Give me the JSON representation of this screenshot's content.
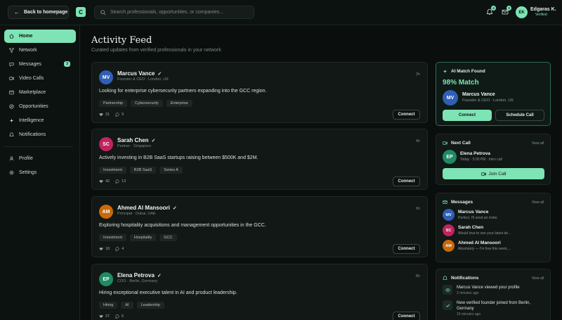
{
  "topbar": {
    "back_label": "Back to homepage",
    "logo_letter": "C",
    "search_placeholder": "Search professionals, opportunities, or companies...",
    "notifications_count": "4",
    "messages_count": "3",
    "user": {
      "initials": "EK",
      "name": "Edgaras K.",
      "status": "Verified"
    }
  },
  "sidebar": {
    "items": [
      {
        "label": "Home",
        "icon": "home-icon"
      },
      {
        "label": "Network",
        "icon": "network-icon"
      },
      {
        "label": "Messages",
        "icon": "chat-icon",
        "badge": "3"
      },
      {
        "label": "Video Calls",
        "icon": "video-icon"
      },
      {
        "label": "Marketplace",
        "icon": "store-icon"
      },
      {
        "label": "Opportunities",
        "icon": "compass-icon"
      },
      {
        "label": "Intelligence",
        "icon": "sparkle-icon"
      },
      {
        "label": "Notifications",
        "icon": "bell-icon"
      }
    ],
    "secondary": [
      {
        "label": "Profile",
        "icon": "user-icon"
      },
      {
        "label": "Settings",
        "icon": "gear-icon"
      }
    ]
  },
  "feed": {
    "title": "Activity Feed",
    "subtitle": "Curated updates from verified professionals in your network",
    "connect_label": "Connect",
    "posts": [
      {
        "initials": "MV",
        "color": "#2f5fb6",
        "name": "Marcus Vance",
        "role": "Founder & CEO · London, UK",
        "time": "2h",
        "body": "Looking for enterprise cybersecurity partners expanding into the GCC region.",
        "tags": [
          "Partnership",
          "Cybersecurity",
          "Enterprise"
        ],
        "likes": "31",
        "comments": "9"
      },
      {
        "initials": "SC",
        "color": "#c0245f",
        "name": "Sarah Chen",
        "role": "Partner · Singapore",
        "time": "4h",
        "body": "Actively investing in B2B SaaS startups raising between $500K and $2M.",
        "tags": [
          "Investment",
          "B2B SaaS",
          "Series A"
        ],
        "likes": "42",
        "comments": "13"
      },
      {
        "initials": "AM",
        "color": "#c9690a",
        "name": "Ahmed Al Mansoori",
        "role": "Principal · Dubai, UAE",
        "time": "6h",
        "body": "Exploring hospitality acquisitions and management opportunities in the GCC.",
        "tags": [
          "Investment",
          "Hospitality",
          "GCC"
        ],
        "likes": "18",
        "comments": "4"
      },
      {
        "initials": "EP",
        "color": "#1f8a63",
        "name": "Elena Petrova",
        "role": "COO · Berlin, Germany",
        "time": "8h",
        "body": "Hiring exceptional executive talent in AI and product leadership.",
        "tags": [
          "Hiring",
          "AI",
          "Leadership"
        ],
        "likes": "27",
        "comments": "6"
      }
    ]
  },
  "ai_match": {
    "title": "AI Match Found",
    "percent": "98% Match",
    "initials": "MV",
    "name": "Marcus Vance",
    "role": "Founder & CEO · London, UK",
    "connect_label": "Connect",
    "schedule_label": "Schedule Call"
  },
  "next_call": {
    "title": "Next Call",
    "view_all": "View all",
    "initials": "EP",
    "name": "Elena Petrova",
    "time": "Today · 5:00 PM · Intro call",
    "join_label": "Join Call"
  },
  "messages": {
    "title": "Messages",
    "view_all": "View all",
    "items": [
      {
        "initials": "MV",
        "color": "#2f5fb6",
        "name": "Marcus Vance",
        "preview": "Perfect, I'll send an invite."
      },
      {
        "initials": "SC",
        "color": "#c0245f",
        "name": "Sarah Chen",
        "preview": "Would love to see your latest de..."
      },
      {
        "initials": "AM",
        "color": "#c9690a",
        "name": "Ahmed Al Mansoori",
        "preview": "Absolutely — I'm free this week,..."
      }
    ]
  },
  "notifications": {
    "title": "Notifications",
    "view_all": "View all",
    "items": [
      {
        "icon": "eye-icon",
        "text": "Marcus Vance viewed your profile",
        "time": "2 minutes ago"
      },
      {
        "icon": "check-icon",
        "text": "New verified founder joined from Berlin, Germany",
        "time": "15 minutes ago"
      }
    ]
  },
  "colors": {
    "accent": "#7ee3b5",
    "background": "#0a0f0d",
    "card": "#121815"
  }
}
